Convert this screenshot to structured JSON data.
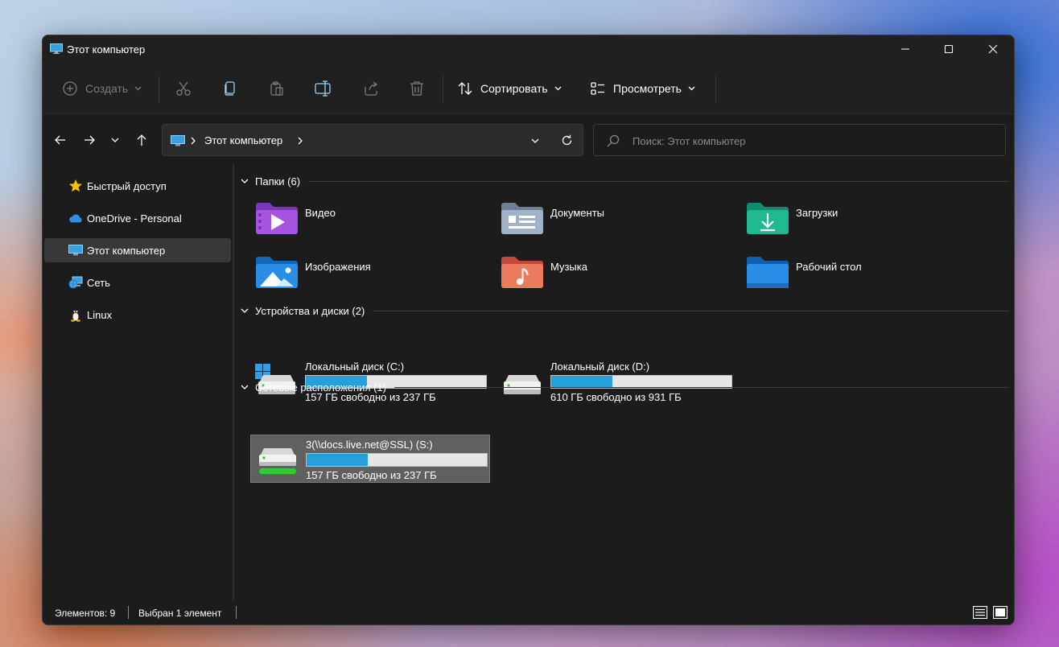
{
  "window": {
    "title": "Этот компьютер"
  },
  "toolbar": {
    "create_label": "Создать",
    "sort_label": "Сортировать",
    "view_label": "Просмотреть"
  },
  "address": {
    "path": "Этот компьютер"
  },
  "search": {
    "placeholder": "Поиск: Этот компьютер"
  },
  "sidebar": {
    "items": [
      {
        "label": "Быстрый доступ",
        "icon": "star-icon"
      },
      {
        "label": "OneDrive - Personal",
        "icon": "cloud-icon"
      },
      {
        "label": "Этот компьютер",
        "icon": "monitor-icon",
        "active": true
      },
      {
        "label": "Сеть",
        "icon": "network-icon"
      },
      {
        "label": "Linux",
        "icon": "linux-penguin-icon"
      }
    ]
  },
  "sections": {
    "folders": "Папки (6)",
    "drives": "Устройства и диски (2)",
    "network": "Сетевые расположения (1)"
  },
  "folders": [
    {
      "name": "Видео",
      "icon": "video-folder-icon"
    },
    {
      "name": "Документы",
      "icon": "documents-folder-icon"
    },
    {
      "name": "Загрузки",
      "icon": "downloads-folder-icon"
    },
    {
      "name": "Изображения",
      "icon": "pictures-folder-icon"
    },
    {
      "name": "Музыка",
      "icon": "music-folder-icon"
    },
    {
      "name": "Рабочий стол",
      "icon": "desktop-folder-icon"
    }
  ],
  "drives": [
    {
      "name": "Локальный диск (C:)",
      "free": "157 ГБ свободно из 237 ГБ",
      "used_fraction": 0.34
    },
    {
      "name": "Локальный диск (D:)",
      "free": "610 ГБ свободно из 931 ГБ",
      "used_fraction": 0.34
    }
  ],
  "network_locations": [
    {
      "name": "3(\\\\docs.live.net@SSL) (S:)",
      "free": "157 ГБ свободно из 237 ГБ",
      "used_fraction": 0.34,
      "selected": true
    }
  ],
  "status": {
    "items_count": "Элементов: 9",
    "selected": "Выбран 1 элемент"
  },
  "colors": {
    "accent": "#26a0da",
    "window_bg": "#1c1c1c",
    "selection": "#606060"
  }
}
